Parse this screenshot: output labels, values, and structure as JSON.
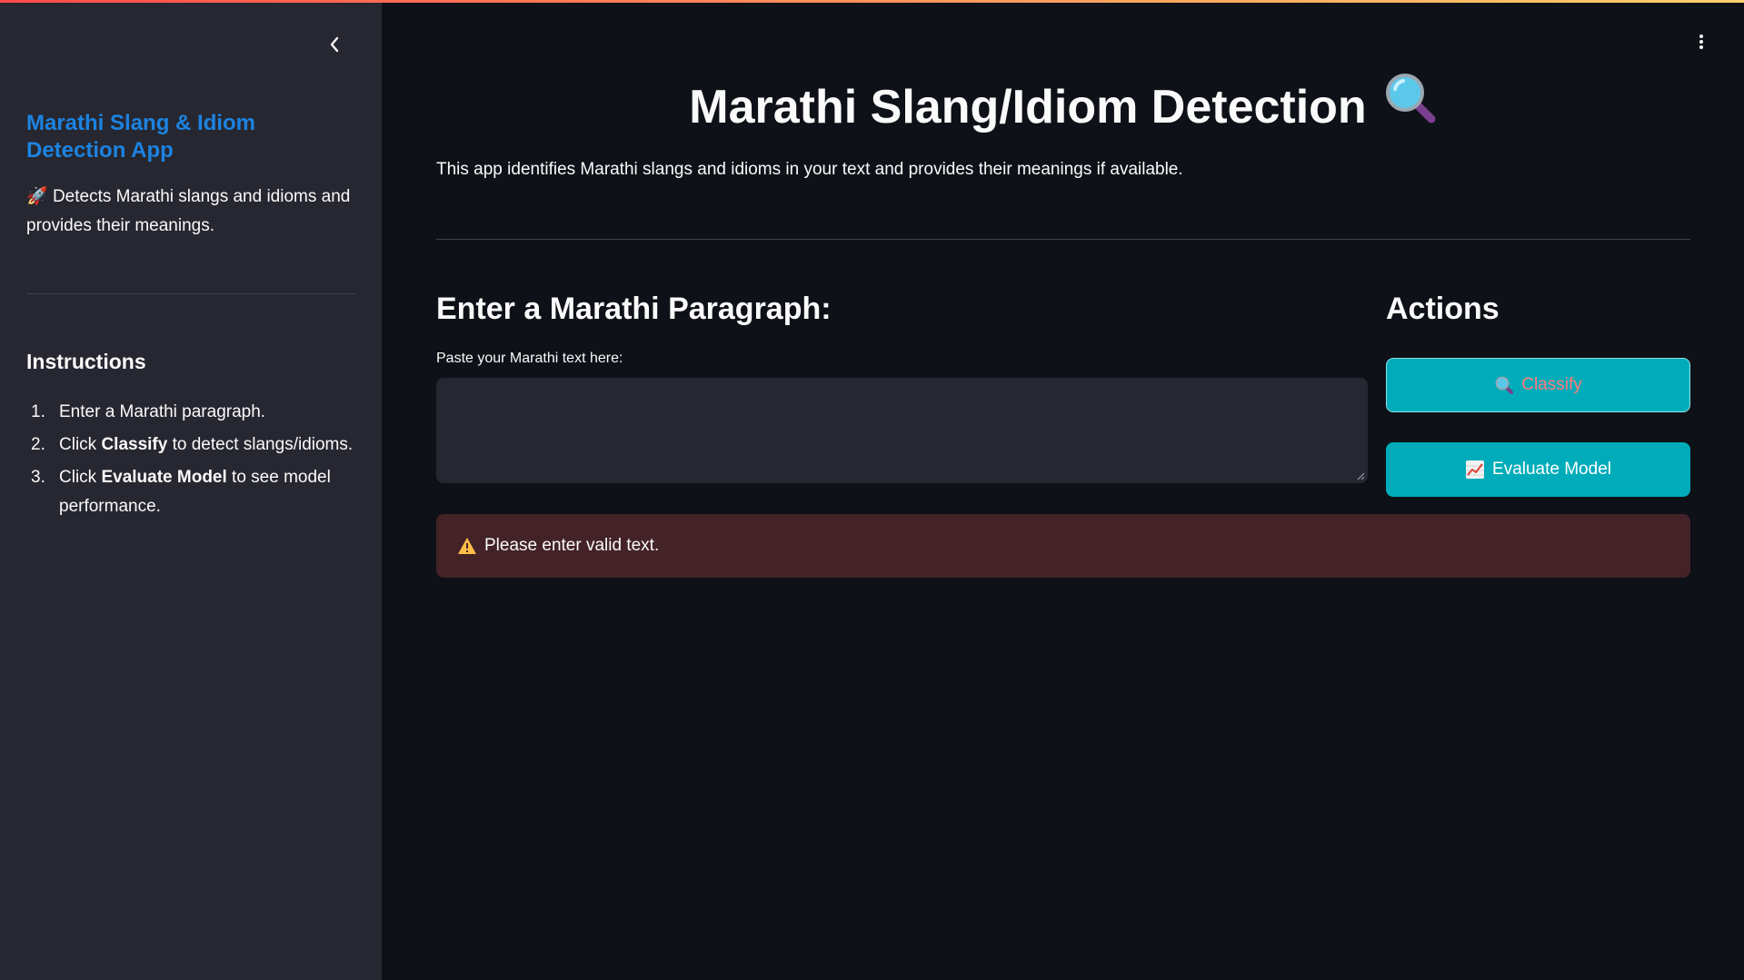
{
  "sidebar": {
    "title": "Marathi Slang & Idiom Detection App",
    "description_emoji": "🚀",
    "description": "Detects Marathi slangs and idioms and provides their meanings.",
    "instructions_heading": "Instructions",
    "instructions": [
      {
        "num": "1.",
        "pre": "Enter a Marathi paragraph.",
        "bold": "",
        "post": ""
      },
      {
        "num": "2.",
        "pre": "Click ",
        "bold": "Classify",
        "post": " to detect slangs/idioms."
      },
      {
        "num": "3.",
        "pre": "Click ",
        "bold": "Evaluate Model",
        "post": " to see model performance."
      }
    ]
  },
  "main": {
    "title": "Marathi Slang/Idiom Detection",
    "title_icon": "magnifying-glass-emoji",
    "description": "This app identifies Marathi slangs and idioms in your text and provides their meanings if available.",
    "input_heading": "Enter a Marathi Paragraph:",
    "input_label": "Paste your Marathi text here:",
    "input_value": "",
    "actions_heading": "Actions",
    "classify_label": "Classify",
    "evaluate_label": "Evaluate Model",
    "warning_text": "Please enter valid text."
  },
  "colors": {
    "background": "#0e1117",
    "sidebar": "#262730",
    "accent_link": "#1c83e1",
    "button": "#00acb9",
    "warning_bg": "#432328",
    "warning_icon": "#ffbd45"
  }
}
